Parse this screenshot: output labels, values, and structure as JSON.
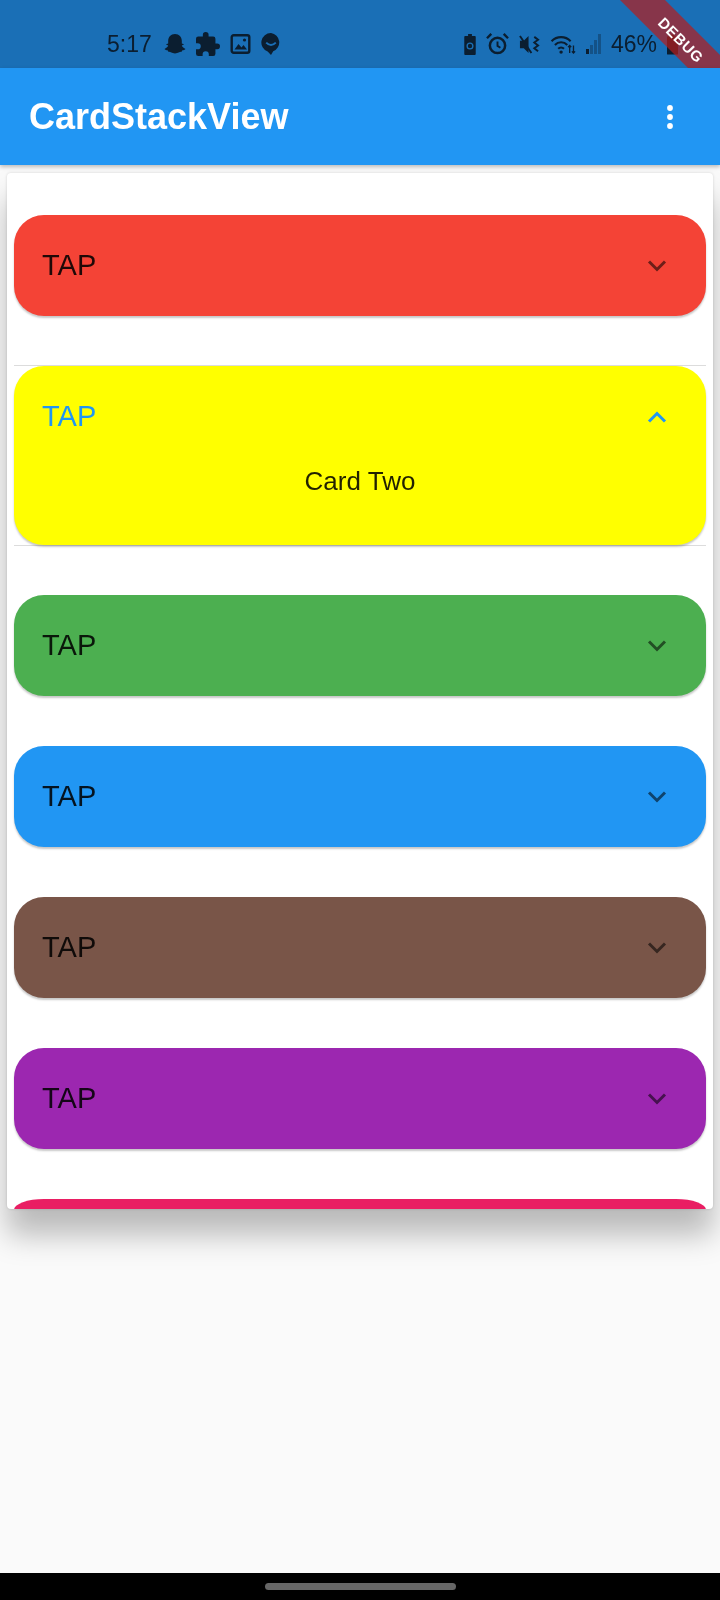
{
  "status_bar": {
    "time": "5:17",
    "battery_percent": "46%"
  },
  "debug_banner": {
    "label": "DEBUG"
  },
  "app_bar": {
    "title": "CardStackView"
  },
  "cards": [
    {
      "kind": "tile",
      "label": "TAP",
      "color": "#f44336",
      "expanded": false
    },
    {
      "kind": "tile",
      "label": "TAP",
      "color": "#ffff00",
      "expanded": true,
      "content": "Card Two"
    },
    {
      "kind": "tile",
      "label": "TAP",
      "color": "#4caf50",
      "expanded": false
    },
    {
      "kind": "tile",
      "label": "TAP",
      "color": "#2196f3",
      "expanded": false
    },
    {
      "kind": "tile",
      "label": "TAP",
      "color": "#795548",
      "expanded": false
    },
    {
      "kind": "tile",
      "label": "TAP",
      "color": "#9c27b0",
      "expanded": false
    },
    {
      "kind": "peek",
      "color": "#e91e63"
    }
  ]
}
